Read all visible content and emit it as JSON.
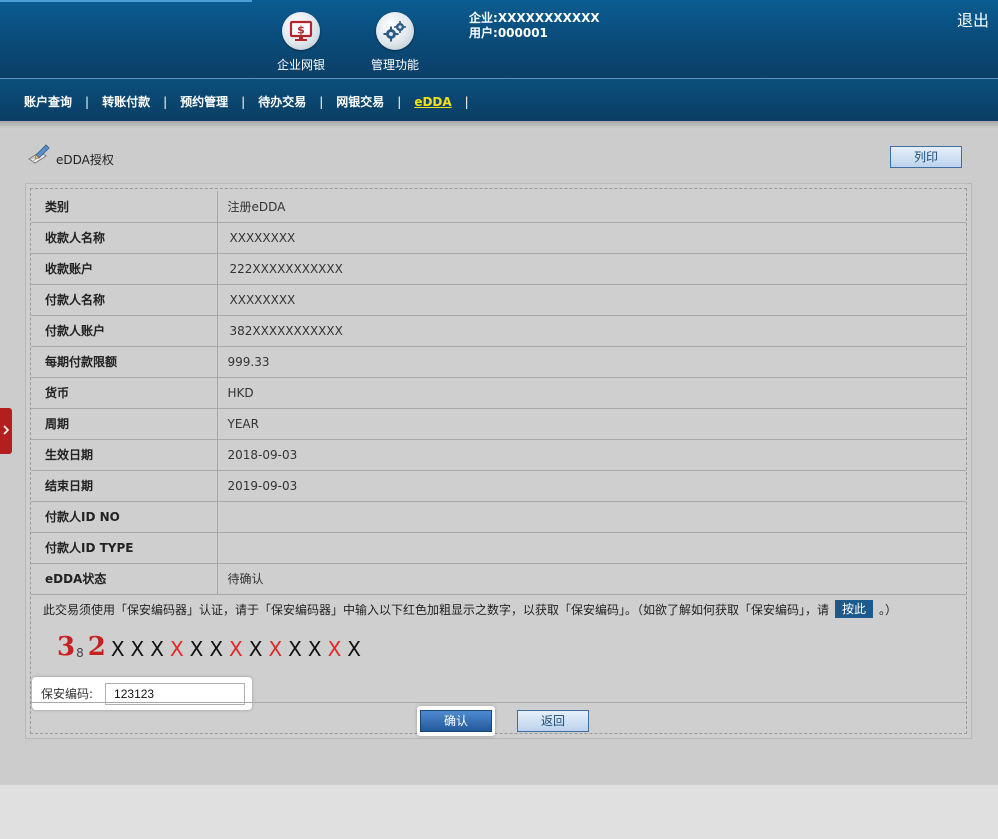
{
  "header": {
    "nav": [
      {
        "label": "企业网银",
        "icon": "monitor-dollar-icon"
      },
      {
        "label": "管理功能",
        "icon": "gears-icon"
      }
    ],
    "company_label": "企业:",
    "company_value": "XXXXXXXXXXX",
    "user_label": "用户:",
    "user_value": "000001",
    "logout": "退出"
  },
  "menu": {
    "items": [
      {
        "label": "账户查询"
      },
      {
        "label": "转账付款"
      },
      {
        "label": "预约管理"
      },
      {
        "label": "待办交易"
      },
      {
        "label": "网银交易"
      },
      {
        "label": "eDDA",
        "active": true
      }
    ],
    "separator": "|"
  },
  "page": {
    "title": "eDDA授权",
    "print_button": "列印"
  },
  "details": [
    {
      "label": "类别",
      "value": "注册eDDA"
    },
    {
      "label": "收款人名称",
      "value": "XXXXXXXX"
    },
    {
      "label": "收款账户",
      "value": "222XXXXXXXXXXX"
    },
    {
      "label": "付款人名称",
      "value": "XXXXXXXX"
    },
    {
      "label": "付款人账户",
      "value": "382XXXXXXXXXXX"
    },
    {
      "label": "每期付款限额",
      "value": "999.33"
    },
    {
      "label": "货币",
      "value": "HKD"
    },
    {
      "label": "周期",
      "value": "YEAR"
    },
    {
      "label": "生效日期",
      "value": "2018-09-03"
    },
    {
      "label": "结束日期",
      "value": "2019-09-03"
    },
    {
      "label": "付款人ID NO",
      "value": ""
    },
    {
      "label": "付款人ID TYPE",
      "value": ""
    },
    {
      "label": "eDDA状态",
      "value": "待确认"
    }
  ],
  "security": {
    "notice_before": "此交易须使用「保安编码器」认证，请于「保安编码器」中输入以下红色加粗显示之数字，以获取「保安编码」。（如欲了解如何获取「保安编码」，请",
    "press_here": "按此",
    "notice_after": "。）",
    "code_prefix": [
      {
        "digit": "3",
        "sub": "8"
      },
      {
        "digit": "2",
        "sub": ""
      }
    ],
    "code_chars": [
      {
        "c": "X",
        "red": false
      },
      {
        "c": "X",
        "red": false
      },
      {
        "c": "X",
        "red": false
      },
      {
        "c": "X",
        "red": true
      },
      {
        "c": "X",
        "red": false
      },
      {
        "c": "X",
        "red": false
      },
      {
        "c": "X",
        "red": true
      },
      {
        "c": "X",
        "red": false
      },
      {
        "c": "X",
        "red": true
      },
      {
        "c": "X",
        "red": false
      },
      {
        "c": "X",
        "red": false
      },
      {
        "c": "X",
        "red": true
      },
      {
        "c": "X",
        "red": false
      }
    ],
    "pin_label": "保安编码:",
    "pin_value": "123123"
  },
  "actions": {
    "confirm": "确认",
    "back": "返回"
  },
  "colors": {
    "header_blue": "#0a4d7c",
    "menu_active": "#f1e21a",
    "code_red": "#e22828",
    "sidebar_tab": "#b41e1e"
  }
}
